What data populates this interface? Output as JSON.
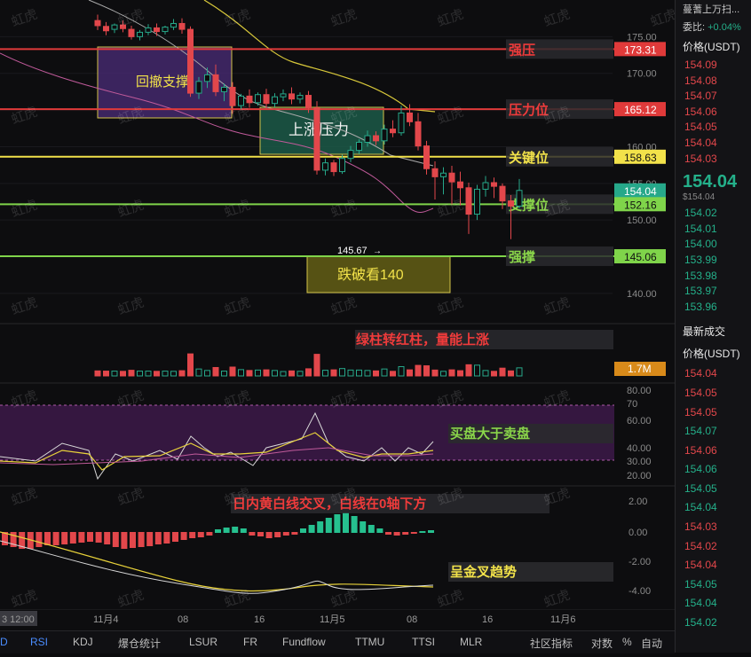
{
  "watermark": "虹虎",
  "price_axis": {
    "ticks": [
      "175.00",
      "170.00",
      "165.00",
      "160.00",
      "155.00",
      "150.00",
      "145.00",
      "140.00"
    ],
    "badges": [
      {
        "label": "173.31",
        "color": "#e03a3a"
      },
      {
        "label": "165.12",
        "color": "#e03a3a"
      },
      {
        "label": "158.63",
        "color": "#f2e24a"
      },
      {
        "label": "154.04",
        "color": "#26a88a"
      },
      {
        "label": "152.16",
        "color": "#7fd44a"
      },
      {
        "label": "145.06",
        "color": "#7fd44a"
      }
    ]
  },
  "levels": [
    {
      "name": "强压",
      "value": 173.31,
      "color": "#e03a3a"
    },
    {
      "name": "压力位",
      "value": 165.12,
      "color": "#e03a3a"
    },
    {
      "name": "关键位",
      "value": 158.63,
      "color": "#f2e24a"
    },
    {
      "name": "支撑位",
      "value": 152.16,
      "color": "#7fd44a"
    },
    {
      "name": "强撑",
      "value": 145.06,
      "color": "#7fd44a"
    }
  ],
  "annotations": {
    "retrace_support": "回撤支撑",
    "rise_pressure": "上涨压力",
    "break_target": "跌破看140",
    "low_marker": "145.67",
    "volume_note": "绿柱转红柱，量能上涨",
    "rsi_note": "买盘大于卖盘",
    "macd_note": "日内黄白线交叉，白线在0轴下方",
    "kdj_note": "呈金叉趋势",
    "volume_badge": "1.7M"
  },
  "rsi_axis": [
    "80.00",
    "70",
    "60.00",
    "40.00",
    "30.00",
    "20.00"
  ],
  "macd_axis": [
    "2.00",
    "0.00",
    "-2.00",
    "-4.00"
  ],
  "time_axis": [
    "3 12:00",
    "11月4",
    "08",
    "16",
    "11月5",
    "08",
    "16",
    "11月6"
  ],
  "bottom_tabs": [
    "D",
    "RSI",
    "KDJ",
    "爆仓统计",
    "LSUR",
    "FR",
    "Fundflow",
    "TTMU",
    "TTSI",
    "MLR",
    "社区指标",
    "对数",
    "%",
    "自动"
  ],
  "sidebar": {
    "top_title": "蔓蓍上万扫...",
    "ratio_label": "委比:",
    "ratio_value": "+0.04%",
    "price_header": "价格(USDT)",
    "asks": [
      "154.09",
      "154.08",
      "154.07",
      "154.06",
      "154.05",
      "154.04",
      "154.03"
    ],
    "last": "154.04",
    "last_usd": "$154.04",
    "bids": [
      "154.02",
      "154.01",
      "154.00",
      "153.99",
      "153.98",
      "153.97",
      "153.96"
    ],
    "trades_title": "最新成交",
    "trades_header": "价格(USDT)",
    "trades": [
      {
        "p": "154.04",
        "c": "red"
      },
      {
        "p": "154.05",
        "c": "red"
      },
      {
        "p": "154.05",
        "c": "red"
      },
      {
        "p": "154.07",
        "c": "green"
      },
      {
        "p": "154.06",
        "c": "red"
      },
      {
        "p": "154.06",
        "c": "green"
      },
      {
        "p": "154.05",
        "c": "green"
      },
      {
        "p": "154.04",
        "c": "green"
      },
      {
        "p": "154.03",
        "c": "red"
      },
      {
        "p": "154.02",
        "c": "red"
      },
      {
        "p": "154.04",
        "c": "red"
      },
      {
        "p": "154.05",
        "c": "green"
      },
      {
        "p": "154.04",
        "c": "green"
      },
      {
        "p": "154.02",
        "c": "green"
      }
    ]
  },
  "chart_data": {
    "type": "candlestick",
    "ylim": [
      136,
      180
    ],
    "candles": [
      {
        "o": 177.2,
        "h": 178.0,
        "c": 176.5,
        "l": 175.9
      },
      {
        "o": 176.4,
        "h": 177.0,
        "c": 175.8,
        "l": 175.2
      },
      {
        "o": 176.0,
        "h": 176.8,
        "c": 176.6,
        "l": 175.5
      },
      {
        "o": 176.6,
        "h": 177.2,
        "c": 176.1,
        "l": 175.6
      },
      {
        "o": 176.0,
        "h": 176.5,
        "c": 175.0,
        "l": 174.6
      },
      {
        "o": 175.0,
        "h": 175.9,
        "c": 175.6,
        "l": 174.5
      },
      {
        "o": 175.6,
        "h": 176.7,
        "c": 176.2,
        "l": 175.2
      },
      {
        "o": 176.2,
        "h": 176.8,
        "c": 175.7,
        "l": 175.1
      },
      {
        "o": 175.7,
        "h": 176.5,
        "c": 176.3,
        "l": 175.3
      },
      {
        "o": 176.3,
        "h": 177.4,
        "c": 176.8,
        "l": 175.9
      },
      {
        "o": 176.8,
        "h": 177.5,
        "c": 176.0,
        "l": 175.4
      },
      {
        "o": 176.0,
        "h": 176.4,
        "c": 167.3,
        "l": 166.8
      },
      {
        "o": 167.3,
        "h": 169.5,
        "c": 168.9,
        "l": 166.5
      },
      {
        "o": 168.9,
        "h": 170.8,
        "c": 169.8,
        "l": 168.0
      },
      {
        "o": 169.8,
        "h": 171.2,
        "c": 167.5,
        "l": 166.9
      },
      {
        "o": 167.5,
        "h": 168.6,
        "c": 168.1,
        "l": 166.2
      },
      {
        "o": 168.1,
        "h": 168.8,
        "c": 165.6,
        "l": 164.5
      },
      {
        "o": 165.6,
        "h": 167.2,
        "c": 166.9,
        "l": 165.1
      },
      {
        "o": 166.9,
        "h": 167.8,
        "c": 166.0,
        "l": 165.3
      },
      {
        "o": 166.0,
        "h": 167.4,
        "c": 167.1,
        "l": 165.6
      },
      {
        "o": 167.1,
        "h": 167.9,
        "c": 165.9,
        "l": 165.2
      },
      {
        "o": 165.9,
        "h": 167.3,
        "c": 166.8,
        "l": 165.4
      },
      {
        "o": 166.8,
        "h": 167.8,
        "c": 167.2,
        "l": 166.2
      },
      {
        "o": 167.2,
        "h": 168.1,
        "c": 166.5,
        "l": 165.8
      },
      {
        "o": 166.5,
        "h": 167.4,
        "c": 167.0,
        "l": 165.9
      },
      {
        "o": 167.0,
        "h": 167.6,
        "c": 165.3,
        "l": 164.6
      },
      {
        "o": 165.3,
        "h": 166.2,
        "c": 156.8,
        "l": 156.2
      },
      {
        "o": 156.8,
        "h": 158.4,
        "c": 157.8,
        "l": 156.1
      },
      {
        "o": 157.8,
        "h": 158.2,
        "c": 156.6,
        "l": 156.0
      },
      {
        "o": 156.6,
        "h": 158.9,
        "c": 158.4,
        "l": 156.3
      },
      {
        "o": 158.4,
        "h": 160.1,
        "c": 159.5,
        "l": 157.9
      },
      {
        "o": 159.5,
        "h": 161.0,
        "c": 160.6,
        "l": 159.0
      },
      {
        "o": 160.6,
        "h": 162.2,
        "c": 161.5,
        "l": 160.0
      },
      {
        "o": 161.5,
        "h": 162.1,
        "c": 160.8,
        "l": 160.2
      },
      {
        "o": 160.8,
        "h": 163.0,
        "c": 162.4,
        "l": 160.3
      },
      {
        "o": 162.4,
        "h": 163.6,
        "c": 161.9,
        "l": 161.3
      },
      {
        "o": 161.9,
        "h": 165.6,
        "c": 164.6,
        "l": 161.5
      },
      {
        "o": 164.6,
        "h": 165.8,
        "c": 163.4,
        "l": 162.8
      },
      {
        "o": 163.4,
        "h": 164.6,
        "c": 160.1,
        "l": 159.5
      },
      {
        "o": 160.1,
        "h": 160.8,
        "c": 157.0,
        "l": 156.2
      },
      {
        "o": 157.0,
        "h": 158.0,
        "c": 155.9,
        "l": 152.8
      },
      {
        "o": 155.9,
        "h": 157.2,
        "c": 156.4,
        "l": 153.5
      },
      {
        "o": 156.4,
        "h": 157.4,
        "c": 155.2,
        "l": 152.1
      },
      {
        "o": 155.2,
        "h": 156.6,
        "c": 154.4,
        "l": 152.0
      },
      {
        "o": 154.4,
        "h": 155.1,
        "c": 150.8,
        "l": 148.1
      },
      {
        "o": 150.8,
        "h": 154.8,
        "c": 154.2,
        "l": 150.0
      },
      {
        "o": 154.2,
        "h": 156.0,
        "c": 155.1,
        "l": 153.2
      },
      {
        "o": 155.1,
        "h": 155.8,
        "c": 154.6,
        "l": 153.0
      },
      {
        "o": 154.6,
        "h": 155.0,
        "c": 152.6,
        "l": 151.5
      },
      {
        "o": 152.6,
        "h": 153.4,
        "c": 151.9,
        "l": 147.4
      },
      {
        "o": 151.9,
        "h": 155.6,
        "c": 154.04,
        "l": 151.6
      }
    ]
  }
}
